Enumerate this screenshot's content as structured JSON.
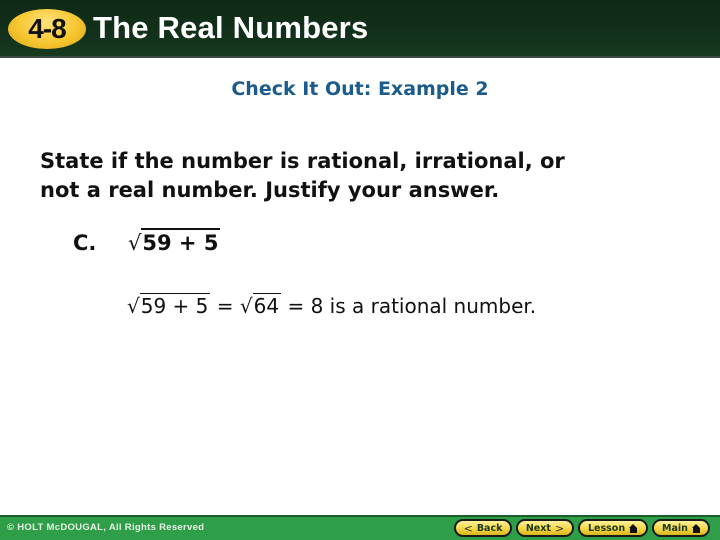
{
  "header": {
    "badge": "4-8",
    "title": "The Real Numbers"
  },
  "subtitle": "Check It Out: Example 2",
  "prompt": {
    "line1": "State if the number is rational, irrational, or",
    "line2": "not a real number. Justify your answer."
  },
  "problem": {
    "letter": "C.",
    "radical_sign": "√",
    "radicand": "59 + 5"
  },
  "solution": {
    "radical_sign": "√",
    "radicand1": "59 + 5",
    "equals1": " = ",
    "radicand2": "64",
    "rest": " = 8 is a rational number."
  },
  "footer": {
    "copyright": "© HOLT McDOUGAL, All Rights Reserved",
    "nav": {
      "back": "Back",
      "next": "Next",
      "lesson": "Lesson",
      "main": "Main",
      "back_icon": "chevron-left-icon",
      "next_icon": "chevron-right-icon",
      "home_icon": "home-icon"
    }
  },
  "colors": {
    "header_bg": "#12301a",
    "badge": "#f6c630",
    "subtitle": "#1b5c8c",
    "footer_bg": "#2f9e48",
    "nav_button": "#f3d440"
  }
}
